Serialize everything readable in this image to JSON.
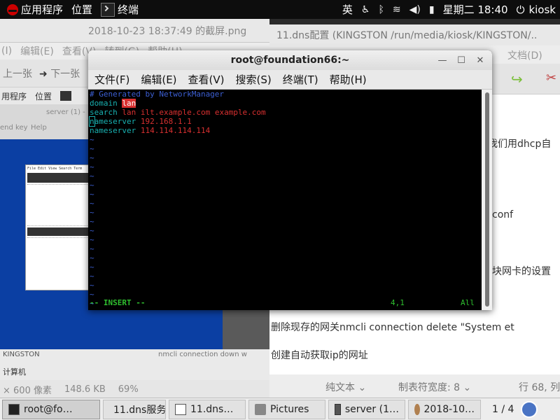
{
  "topbar": {
    "apps_label": "应用程序",
    "places_label": "位置",
    "active_app": "终端",
    "input_method": "英",
    "clock": "星期二 18:40",
    "user": "kiosk"
  },
  "viewer": {
    "title": "2018-10-23 18:37:49 的截屏.png",
    "menu": [
      "(I)",
      "编辑(E)",
      "查看(V)",
      "转到(G)",
      "帮助(H)"
    ],
    "toolbar": [
      "上一张",
      "下一张"
    ],
    "status": [
      "× 600 像素",
      "148.6 KB",
      "69%"
    ],
    "nested": {
      "topbar": [
        "用程序",
        "位置"
      ],
      "window_title": "server (1) -",
      "send_key": "end key",
      "help": "Help",
      "term_menu": "File  Edit  View  Search  Term",
      "bottom_left": "KINGSTON",
      "computer": "计算机",
      "nmcli": "nmcli connection down w"
    }
  },
  "gedit": {
    "title": "11.dns配置 (KINGSTON /run/media/kiosk/KINGSTON/..",
    "menu_doc": "文档(D)",
    "lines": {
      "l1": "我们用dhcp自",
      "l2": "conf",
      "l3": "块网卡的设置",
      "l4": "删除现存的网关nmcli connection delete \"System et",
      "l5": "创建自动获取ip的网址"
    },
    "status": {
      "mode": "纯文本",
      "tab": "制表符宽度: 8",
      "pos": "行 68, 列"
    }
  },
  "terminal": {
    "title": "root@foundation66:~",
    "menu": [
      "文件(F)",
      "编辑(E)",
      "查看(V)",
      "搜索(S)",
      "终端(T)",
      "帮助(H)"
    ],
    "lines": {
      "comment": "# Generated by NetworkManager",
      "domain_kw": "domain",
      "domain_val": "lan",
      "search_kw": "search",
      "search_val": "lan ilt.example.com example.com",
      "ns1_first": "n",
      "ns1_rest": "ameserver",
      "ns1_val": "192.168.1.1",
      "ns2_kw": "nameserver",
      "ns2_val": "114.114.114.114"
    },
    "tilde_count": 19,
    "mode": "-- INSERT --",
    "cursor_pos": "4,1",
    "scroll_pos": "All"
  },
  "taskbar": {
    "tasks": [
      "root@fo…",
      "11.dns服务",
      "11.dns…",
      "Pictures",
      "server (1…",
      "2018-10…"
    ],
    "pager": "1 / 4"
  },
  "colors": {
    "comment": "#3c5fd3",
    "keyword": "#18b0b0",
    "value": "#d83030",
    "insert": "#2fbf2f"
  }
}
